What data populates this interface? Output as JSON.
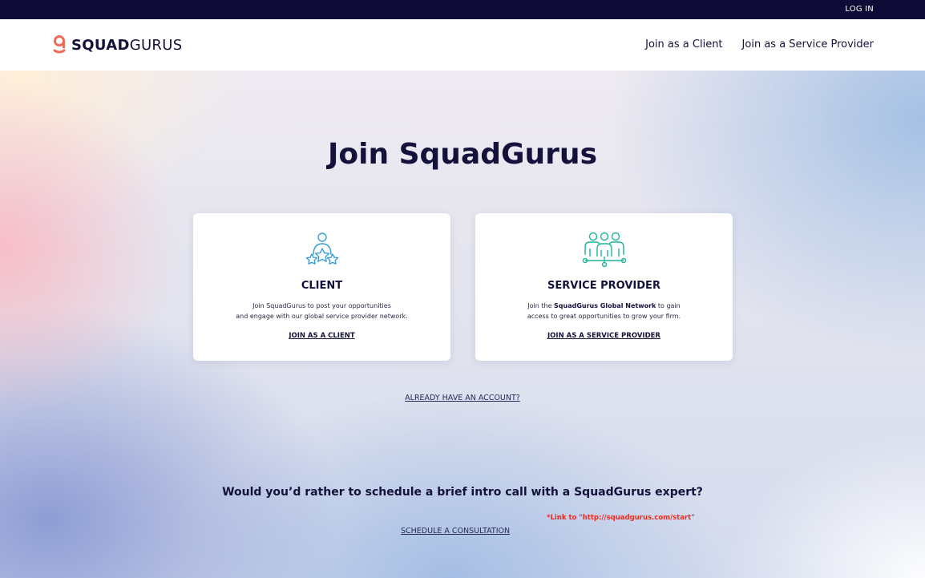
{
  "topbar": {
    "login_label": "LOG IN"
  },
  "header": {
    "logo_bold": "SQUAD",
    "logo_light": "GURUS",
    "nav": [
      "Join as a Client",
      "Join as a Service Provider"
    ]
  },
  "main": {
    "title": "Join SquadGurus",
    "cards": [
      {
        "icon": "client-stars-icon",
        "title": "CLIENT",
        "desc_line1": "Join SquadGurus to post your opportunities",
        "desc_line2": "and engage with our global service provider network.",
        "link": "JOIN AS A CLIENT"
      },
      {
        "icon": "team-network-icon",
        "title": "SERVICE PROVIDER",
        "desc_line1_pre": "Join the ",
        "desc_line1_bold": "SquadGurus Global Network",
        "desc_line1_post": " to gain",
        "desc_line2": "access to great opportunities to grow your firm.",
        "link": "JOIN AS A SERVICE PROVIDER"
      }
    ],
    "already_link": "ALREADY HAVE AN ACCOUNT?",
    "question": "Would you’d rather to schedule a brief intro call with a SquadGurus expert?",
    "schedule_link": "SCHEDULE A CONSULTATION",
    "annotation": "*Link to \"http://squadgurus.com/start\""
  },
  "colors": {
    "topbar": "#0e0c36",
    "text": "#14123a",
    "logo_accent": "#f06a5a",
    "client_icon": "#3a9fd8",
    "provider_icon": "#1fb39c",
    "annotation": "#f02a20"
  }
}
